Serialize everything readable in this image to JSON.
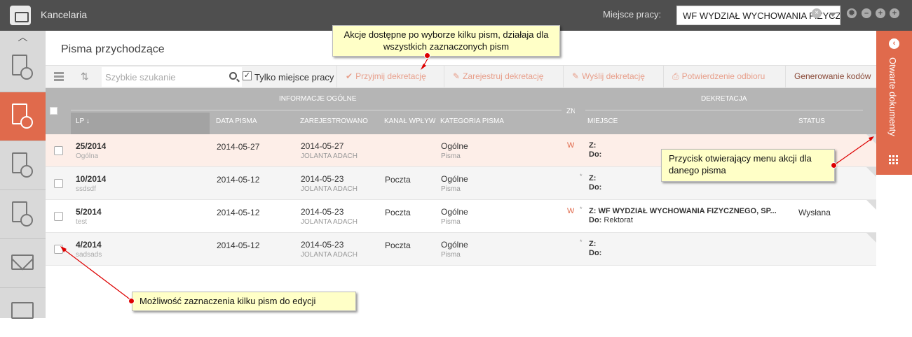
{
  "topbar": {
    "app_title": "Kancelaria",
    "workspace_label": "Miejsce pracy:",
    "workspace_value": "WF WYDZIAŁ WYCHOWANIA FIZYCZNEGO"
  },
  "page": {
    "title": "Pisma przychodzące"
  },
  "toolbar": {
    "search_placeholder": "Szybkie szukanie",
    "only_workplace_label": "Tylko miejsce pracy",
    "buttons": [
      {
        "label": "Przyjmij dekretację",
        "icon": "check-icon"
      },
      {
        "label": "Zarejestruj dekretację",
        "icon": "edit-icon"
      },
      {
        "label": "Wyślij dekretację",
        "icon": "edit-icon"
      },
      {
        "label": "Potwierdzenie odbioru",
        "icon": "print-icon"
      },
      {
        "label": "Generowanie kodów",
        "icon": ""
      }
    ]
  },
  "grid": {
    "group_info": "INFORMACJE OGÓLNE",
    "group_dekretacja": "DEKRETACJA",
    "columns": {
      "lp": "LP",
      "data": "DATA PISMA",
      "zarejestrowano": "ZAREJESTROWANO",
      "kanal": "KANAŁ WPŁYWU",
      "kategoria": "KATEGORIA PISMA",
      "zn": "ZN",
      "miejsce": "MIEJSCE",
      "status": "STATUS"
    },
    "rows": [
      {
        "lp": "25/2014",
        "sub": "Ogólna",
        "data": "2014-05-27",
        "zar": "2014-05-27",
        "zar_user": "JOLANTA ADACH",
        "kanal": "",
        "kat": "Ogólne",
        "kat_sub": "Pisma",
        "w": "W",
        "star": "",
        "z": "Z:",
        "do_label": "Do:",
        "do_value": "",
        "status": ""
      },
      {
        "lp": "10/2014",
        "sub": "ssdsdf",
        "data": "2014-05-12",
        "zar": "2014-05-23",
        "zar_user": "JOLANTA ADACH",
        "kanal": "Poczta",
        "kat": "Ogólne",
        "kat_sub": "Pisma",
        "w": "",
        "star": "*",
        "z": "Z:",
        "do_label": "Do:",
        "do_value": "",
        "status": ""
      },
      {
        "lp": "5/2014",
        "sub": "test",
        "data": "2014-05-12",
        "zar": "2014-05-23",
        "zar_user": "JOLANTA ADACH",
        "kanal": "Poczta",
        "kat": "Ogólne",
        "kat_sub": "Pisma",
        "w": "W",
        "star": "*",
        "z": "Z: WF WYDZIAŁ WYCHOWANIA FIZYCZNEGO, SP...",
        "do_label": "Do:",
        "do_value": " Rektorat",
        "status": "Wysłana"
      },
      {
        "lp": "4/2014",
        "sub": "sadsads",
        "data": "2014-05-12",
        "zar": "2014-05-23",
        "zar_user": "JOLANTA ADACH",
        "kanal": "Poczta",
        "kat": "Ogólne",
        "kat_sub": "Pisma",
        "w": "",
        "star": "*",
        "z": "Z:",
        "do_label": "Do:",
        "do_value": "",
        "status": ""
      }
    ]
  },
  "open_docs": {
    "label": "Otwarte dokumenty"
  },
  "callouts": {
    "actions": "Akcje dostępne po wyborze kilku pism, działaja dla wszystkich zaznaczonych pism",
    "menu": "Przycisk otwierający menu akcji dla danego pisma",
    "select": "Możliwość zaznaczenia kilku pism do edycji"
  },
  "colors": {
    "accent": "#e06a4c",
    "topbar": "#4f4f4f",
    "callout": "#ffffc7"
  }
}
